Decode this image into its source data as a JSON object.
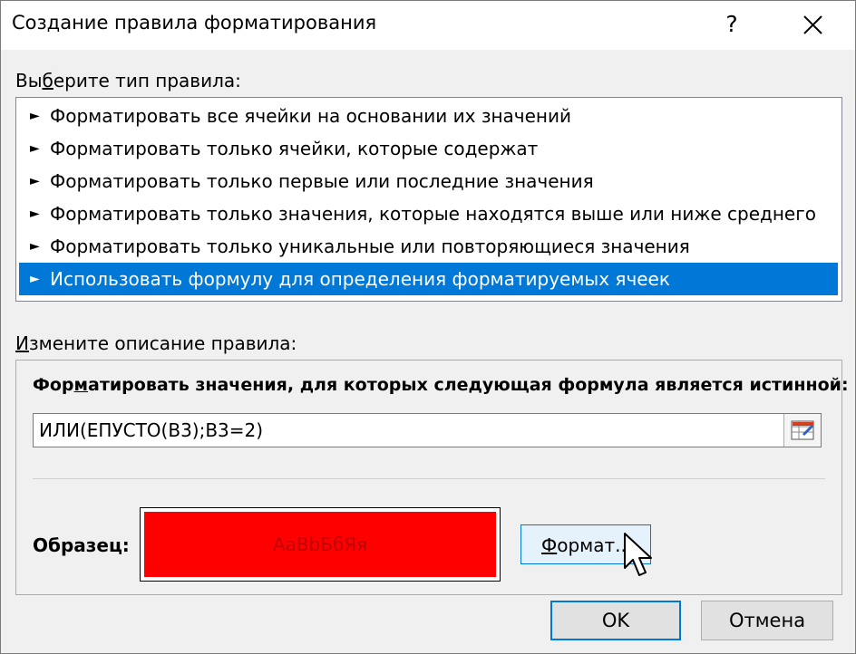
{
  "dialog": {
    "title": "Создание правила форматирования",
    "help_label": "?",
    "close_icon": "close-icon"
  },
  "rule_type": {
    "label_prefix": "Вы",
    "label_underlined": "б",
    "label_suffix": "ерите тип правила:",
    "arrow_glyph": "►",
    "items": [
      {
        "label": "Форматировать все ячейки на основании их значений",
        "selected": false
      },
      {
        "label": "Форматировать только ячейки, которые содержат",
        "selected": false
      },
      {
        "label": "Форматировать только первые или последние значения",
        "selected": false
      },
      {
        "label": "Форматировать только значения, которые находятся выше или ниже среднего",
        "selected": false
      },
      {
        "label": "Форматировать только уникальные или повторяющиеся значения",
        "selected": false
      },
      {
        "label": "Использовать формулу для определения форматируемых ячеек",
        "selected": true
      }
    ]
  },
  "description": {
    "label_underlined": "И",
    "label_suffix": "змените описание правила:",
    "formula_label_prefix": "Фор",
    "formula_label_underlined": "м",
    "formula_label_suffix": "атировать значения, для которых следующая формула является истинной:",
    "formula_value": "ИЛИ(ЕПУСТО(B3);B3=2)",
    "collapse_icon": "range-select-icon",
    "preview_label": "Образец:",
    "preview_text": "AaBbБбЯя",
    "preview_fill": "#ff0000",
    "preview_text_color": "#c00000",
    "format_button_underlined": "Ф",
    "format_button_suffix": "ормат..."
  },
  "buttons": {
    "ok": "OK",
    "cancel": "Отмена"
  },
  "colors": {
    "selection": "#0078d7",
    "focus_border": "#0078d7"
  }
}
